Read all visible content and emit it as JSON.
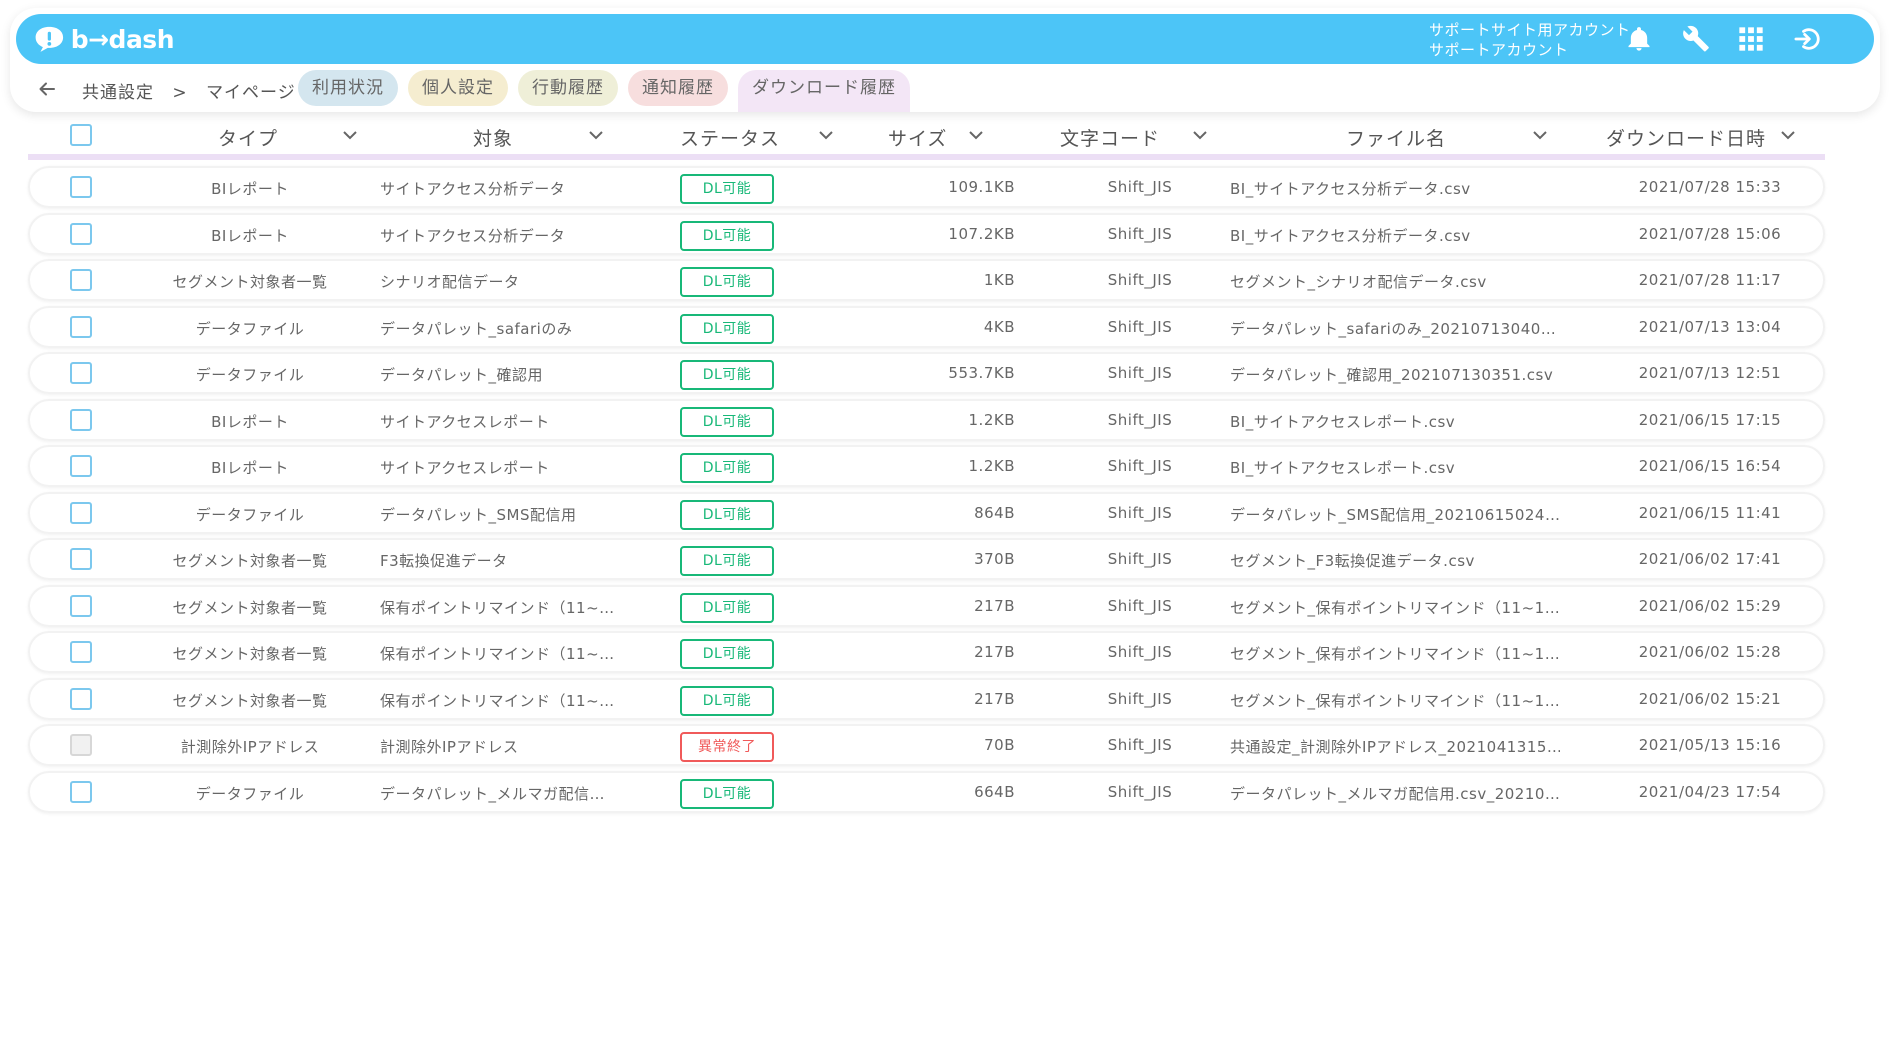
{
  "header": {
    "logo_text": "b→dash",
    "account_line1": "サポートサイト用アカウント",
    "account_line2": "サポートアカウント",
    "icons": [
      "bell-icon",
      "wrench-icon",
      "grid-icon",
      "logout-icon"
    ],
    "color": "#4cc5f7"
  },
  "subnav": {
    "breadcrumb": [
      "共通設定",
      ">",
      "マイページ"
    ],
    "tabs": [
      "利用状況",
      "個人設定",
      "行動履歴",
      "通知履歴",
      "ダウンロード履歴"
    ],
    "active_tab": "ダウンロード履歴"
  },
  "table": {
    "columns": [
      "タイプ",
      "対象",
      "ステータス",
      "サイズ",
      "文字コード",
      "ファイル名",
      "ダウンロード日時"
    ],
    "rows": [
      {
        "type": "BIレポート",
        "target": "サイトアクセス分析データ",
        "status": "DL可能",
        "size": "109.1KB",
        "encoding": "Shift_JIS",
        "file": "BI_サイトアクセス分析データ.csv",
        "date": "2021/07/28 15:33",
        "error": false
      },
      {
        "type": "BIレポート",
        "target": "サイトアクセス分析データ",
        "status": "DL可能",
        "size": "107.2KB",
        "encoding": "Shift_JIS",
        "file": "BI_サイトアクセス分析データ.csv",
        "date": "2021/07/28 15:06",
        "error": false
      },
      {
        "type": "セグメント対象者一覧",
        "target": "シナリオ配信データ",
        "status": "DL可能",
        "size": "1KB",
        "encoding": "Shift_JIS",
        "file": "セグメント_シナリオ配信データ.csv",
        "date": "2021/07/28 11:17",
        "error": false
      },
      {
        "type": "データファイル",
        "target": "データパレット_safariのみ",
        "status": "DL可能",
        "size": "4KB",
        "encoding": "Shift_JIS",
        "file": "データパレット_safariのみ_20210713040…",
        "date": "2021/07/13 13:04",
        "error": false
      },
      {
        "type": "データファイル",
        "target": "データパレット_確認用",
        "status": "DL可能",
        "size": "553.7KB",
        "encoding": "Shift_JIS",
        "file": "データパレット_確認用_202107130351.csv",
        "date": "2021/07/13 12:51",
        "error": false
      },
      {
        "type": "BIレポート",
        "target": "サイトアクセスレポート",
        "status": "DL可能",
        "size": "1.2KB",
        "encoding": "Shift_JIS",
        "file": "BI_サイトアクセスレポート.csv",
        "date": "2021/06/15 17:15",
        "error": false
      },
      {
        "type": "BIレポート",
        "target": "サイトアクセスレポート",
        "status": "DL可能",
        "size": "1.2KB",
        "encoding": "Shift_JIS",
        "file": "BI_サイトアクセスレポート.csv",
        "date": "2021/06/15 16:54",
        "error": false
      },
      {
        "type": "データファイル",
        "target": "データパレット_SMS配信用",
        "status": "DL可能",
        "size": "864B",
        "encoding": "Shift_JIS",
        "file": "データパレット_SMS配信用_20210615024…",
        "date": "2021/06/15 11:41",
        "error": false
      },
      {
        "type": "セグメント対象者一覧",
        "target": "F3転換促進データ",
        "status": "DL可能",
        "size": "370B",
        "encoding": "Shift_JIS",
        "file": "セグメント_F3転換促進データ.csv",
        "date": "2021/06/02 17:41",
        "error": false
      },
      {
        "type": "セグメント対象者一覧",
        "target": "保有ポイントリマインド（11~…",
        "status": "DL可能",
        "size": "217B",
        "encoding": "Shift_JIS",
        "file": "セグメント_保有ポイントリマインド（11~1…",
        "date": "2021/06/02 15:29",
        "error": false
      },
      {
        "type": "セグメント対象者一覧",
        "target": "保有ポイントリマインド（11~…",
        "status": "DL可能",
        "size": "217B",
        "encoding": "Shift_JIS",
        "file": "セグメント_保有ポイントリマインド（11~1…",
        "date": "2021/06/02 15:28",
        "error": false
      },
      {
        "type": "セグメント対象者一覧",
        "target": "保有ポイントリマインド（11~…",
        "status": "DL可能",
        "size": "217B",
        "encoding": "Shift_JIS",
        "file": "セグメント_保有ポイントリマインド（11~1…",
        "date": "2021/06/02 15:21",
        "error": false
      },
      {
        "type": "計測除外IPアドレス",
        "target": "計測除外IPアドレス",
        "status": "異常終了",
        "size": "70B",
        "encoding": "Shift_JIS",
        "file": "共通設定_計測除外IPアドレス_2021041315…",
        "date": "2021/05/13 15:16",
        "error": true
      },
      {
        "type": "データファイル",
        "target": "データパレット_メルマガ配信…",
        "status": "DL可能",
        "size": "664B",
        "encoding": "Shift_JIS",
        "file": "データパレット_メルマガ配信用.csv_20210…",
        "date": "2021/04/23 17:54",
        "error": false
      }
    ]
  },
  "colors": {
    "ok": "#18b878",
    "error": "#f05a5a",
    "checkbox": "#7cc8ee"
  }
}
